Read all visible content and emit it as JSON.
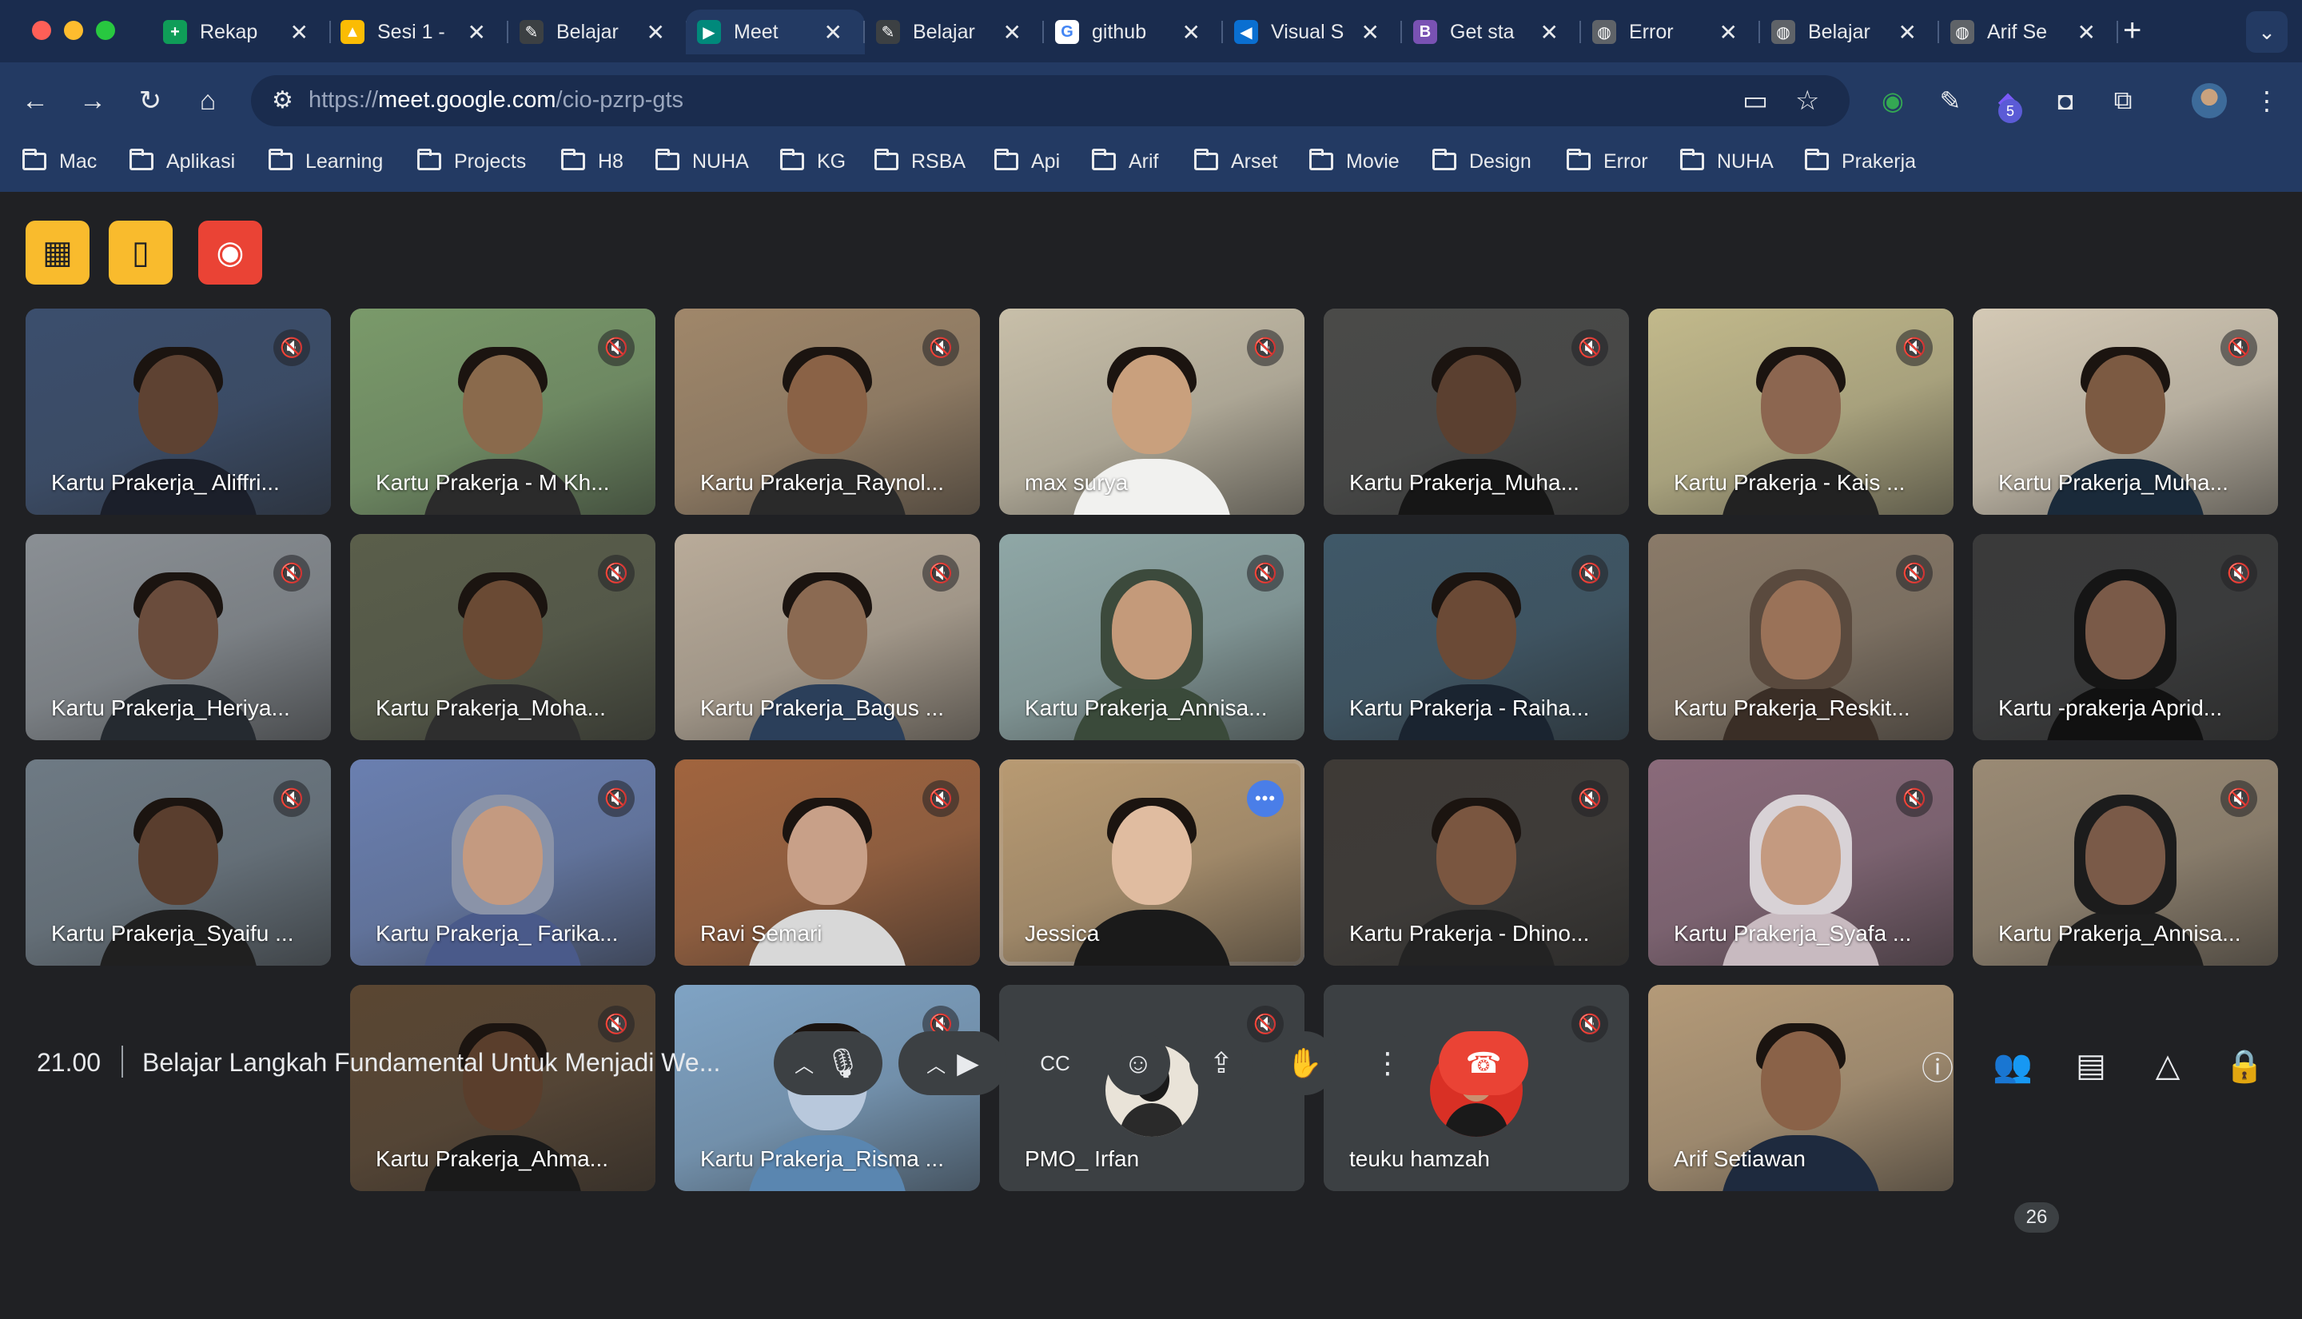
{
  "tabs": [
    {
      "title": "Rekap",
      "icon": "sheets-icon",
      "color": "#0f9d58",
      "glyph": "+"
    },
    {
      "title": "Sesi 1 -",
      "icon": "drive-icon",
      "color": "#fbbc04",
      "glyph": "▲"
    },
    {
      "title": "Belajar",
      "icon": "rocket-icon",
      "color": "#3c4043",
      "glyph": "✎"
    },
    {
      "title": "Meet",
      "icon": "meet-icon",
      "color": "#00897b",
      "glyph": "▶",
      "active": true
    },
    {
      "title": "Belajar",
      "icon": "rocket-icon",
      "color": "#3c4043",
      "glyph": "✎"
    },
    {
      "title": "github",
      "icon": "google-icon",
      "color": "#ffffff",
      "glyph": "G"
    },
    {
      "title": "Visual S",
      "icon": "vscode-icon",
      "color": "#0a6fd1",
      "glyph": "◀"
    },
    {
      "title": "Get sta",
      "icon": "bootstrap-icon",
      "color": "#7952b3",
      "glyph": "B"
    },
    {
      "title": "Error",
      "icon": "globe-icon",
      "color": "#5f6368",
      "glyph": "◍"
    },
    {
      "title": "Belajar",
      "icon": "globe-icon",
      "color": "#5f6368",
      "glyph": "◍"
    },
    {
      "title": "Arif Se",
      "icon": "globe-icon",
      "color": "#5f6368",
      "glyph": "◍"
    }
  ],
  "omnibox": {
    "prefix": "https://",
    "domain": "meet.google.com",
    "path": "/cio-pzrp-gts"
  },
  "extensions_badge": "5",
  "bookmarks": [
    "Mac",
    "Aplikasi",
    "Learning",
    "Projects",
    "H8",
    "NUHA",
    "KG",
    "RSBA",
    "Api",
    "Arif",
    "Arset",
    "Movie",
    "Design",
    "Error",
    "NUHA",
    "Prakerja"
  ],
  "participants": [
    {
      "name": "Kartu Prakerja_ Aliffri...",
      "bg": "#3b4e6d",
      "skin": "#5e4232",
      "shirt": "#1b1f2a",
      "muted": true
    },
    {
      "name": "Kartu Prakerja - M Kh...",
      "bg": "#7a9a6a",
      "skin": "#8a6a4c",
      "shirt": "#2b2b2b",
      "muted": true
    },
    {
      "name": "Kartu Prakerja_Raynol...",
      "bg": "#a0876a",
      "skin": "#8a6246",
      "shirt": "#2a2a2a",
      "muted": true
    },
    {
      "name": "max surya",
      "bg": "#c8bfa9",
      "skin": "#c9a07d",
      "shirt": "#f1f1ef",
      "muted": true
    },
    {
      "name": "Kartu Prakerja_Muha...",
      "bg": "#4a4a48",
      "skin": "#5b4030",
      "shirt": "#161616",
      "muted": true
    },
    {
      "name": "Kartu Prakerja - Kais ...",
      "bg": "#c2b98b",
      "skin": "#8c6650",
      "shirt": "#222222",
      "muted": true
    },
    {
      "name": "Kartu Prakerja_Muha...",
      "bg": "#d4c9b5",
      "skin": "#7c5a42",
      "shirt": "#1a2a3a",
      "muted": true
    },
    {
      "name": "Kartu Prakerja_Heriya...",
      "bg": "#8a8f94",
      "skin": "#6a4c3c",
      "shirt": "#252a30",
      "muted": true
    },
    {
      "name": "Kartu Prakerja_Moha...",
      "bg": "#5a5e4a",
      "skin": "#6a4a34",
      "shirt": "#2e2e2e",
      "muted": true
    },
    {
      "name": "Kartu Prakerja_Bagus ...",
      "bg": "#b9ab99",
      "skin": "#8b6a52",
      "shirt": "#2b3f5a",
      "muted": true
    },
    {
      "name": "Kartu Prakerja_Annisa...",
      "bg": "#8fa7a6",
      "skin": "#c49a7a",
      "shirt": "#3a4a3a",
      "muted": true,
      "hijab": "#3c4a3c"
    },
    {
      "name": "Kartu Prakerja - Raiha...",
      "bg": "#3f5868",
      "skin": "#6b4a36",
      "shirt": "#1a2430",
      "muted": true
    },
    {
      "name": "Kartu Prakerja_Reskit...",
      "bg": "#8a7a68",
      "skin": "#9a7258",
      "shirt": "#3a2e26",
      "muted": true,
      "hijab": "#5a4a3e"
    },
    {
      "name": "Kartu -prakerja Aprid...",
      "bg": "#3a3a3a",
      "skin": "#7a5a48",
      "shirt": "#111111",
      "muted": true,
      "hijab": "#151515"
    },
    {
      "name": "Kartu Prakerja_Syaifu ...",
      "bg": "#6e7a84",
      "skin": "#5a3e2e",
      "shirt": "#202020",
      "muted": true
    },
    {
      "name": "Kartu Prakerja_ Farika...",
      "bg": "#6a7fb0",
      "skin": "#c49a80",
      "shirt": "#4a5a8a",
      "muted": true,
      "hijab": "#8a93a8"
    },
    {
      "name": "Ravi Semari",
      "bg": "#a1643e",
      "skin": "#c8a088",
      "shirt": "#d8d8d8",
      "muted": true
    },
    {
      "name": "Jessica",
      "bg": "#b89a72",
      "skin": "#e0bca0",
      "shirt": "#1a1a1a",
      "muted": false,
      "speaking": true
    },
    {
      "name": "Kartu Prakerja - Dhino...",
      "bg": "#3e3a36",
      "skin": "#7a5640",
      "shirt": "#232323",
      "muted": true
    },
    {
      "name": "Kartu Prakerja_Syafa ...",
      "bg": "#8a6a7a",
      "skin": "#c49a80",
      "shirt": "#c8bac0",
      "muted": true,
      "hijab": "#d8d2d6"
    },
    {
      "name": "Kartu Prakerja_Annisa...",
      "bg": "#9a8a74",
      "skin": "#7a5a48",
      "shirt": "#1e1e1e",
      "muted": true,
      "hijab": "#1c1c1c"
    },
    {
      "name": "Kartu Prakerja_Ahma...",
      "bg": "#5a4632",
      "skin": "#5a3e2c",
      "shirt": "#1a1a1a",
      "muted": true
    },
    {
      "name": "Kartu Prakerja_Risma ...",
      "bg": "#7fa3c4",
      "skin": "#b8c8dc",
      "shirt": "#5a86b0",
      "muted": true
    },
    {
      "name": "PMO_ Irfan",
      "bg": "#3c4043",
      "avatar": "#e9e3d8",
      "muted": true
    },
    {
      "name": "teuku hamzah",
      "bg": "#3c4043",
      "avatar": "#d93025",
      "muted": true
    },
    {
      "name": "Arif Setiawan",
      "bg": "#b49a78",
      "skin": "#8a6248",
      "shirt": "#1e2a3e",
      "muted": false
    }
  ],
  "host_controls": [
    "layout-icon",
    "building-icon",
    "record-icon"
  ],
  "bottom": {
    "time": "21.00",
    "meeting_title": "Belajar Langkah Fundamental Untuk Menjadi We...",
    "participants_count": "26"
  },
  "colors": {
    "hangup": "#ea4335",
    "host_yellow": "#f9bb2d",
    "record_red": "#ea4335",
    "speaking_outline": "#8ab4f8"
  }
}
